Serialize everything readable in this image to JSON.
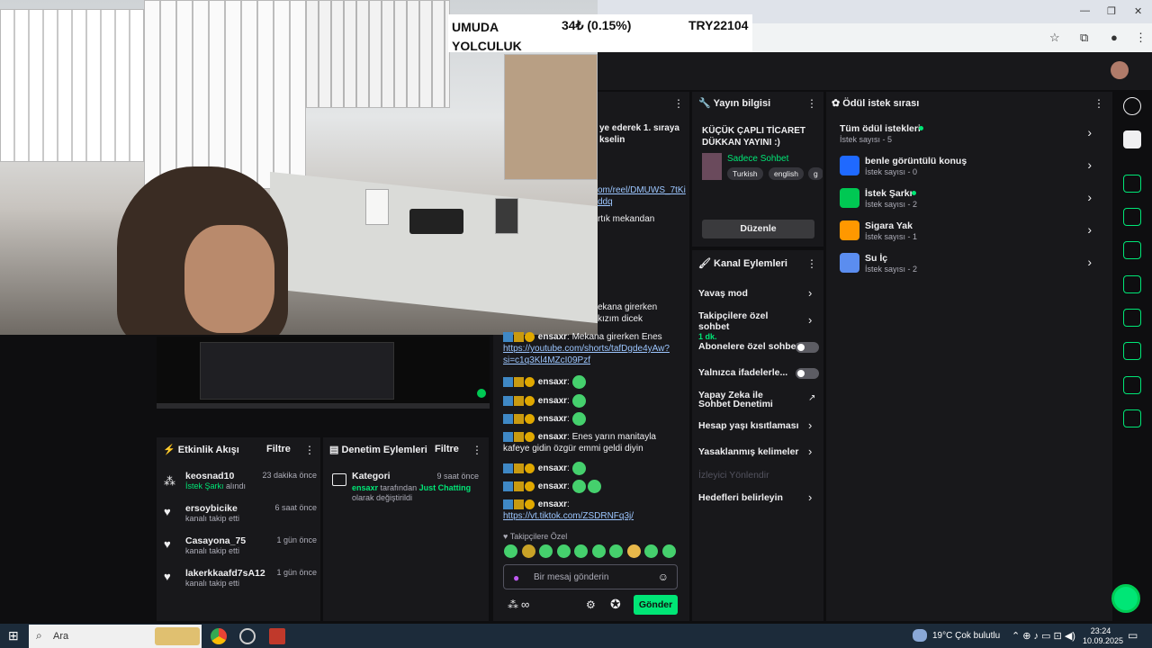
{
  "ticker": {
    "name": "UMUDA YOLCULUK",
    "change": "34₺ (0.15%)",
    "total": "TRY22104"
  },
  "chat_top": {
    "line1": "ye ederek 1. sıraya",
    "line2": "kselin",
    "link1a": "om/reel/DMUWS_7tKi",
    "link1b": "ddq",
    "line3": "rtık mekandan",
    "line4": "ekana girerken",
    "line5": "kızım dicek"
  },
  "stream_info": {
    "header": "Yayın bilgisi",
    "title": "KÜÇÜK ÇAPLI TİCARET DÜKKAN YAYINI :)",
    "category": "Sadece Sohbet",
    "tags": [
      "Turkish",
      "english",
      "g"
    ],
    "edit_button": "Düzenle"
  },
  "channel_actions": {
    "header": "Kanal Eylemleri",
    "items": [
      {
        "label": "Yavaş mod"
      },
      {
        "label": "Takipçilere özel sohbet",
        "sub": "1 dk."
      },
      {
        "label": "Abonelere özel sohbet"
      },
      {
        "label": "Yalnızca ifadelerle..."
      },
      {
        "label": "Yapay Zeka ile Sohbet Denetimi"
      },
      {
        "label": "Hesap yaşı kısıtlaması"
      },
      {
        "label": "Yasaklanmış kelimeler"
      },
      {
        "label": "İzleyici Yönlendir"
      },
      {
        "label": "Hedefleri belirleyin"
      }
    ]
  },
  "rewards": {
    "header": "Ödül istek sırası",
    "all": {
      "title": "Tüm ödül istekleri",
      "sub": "İstek sayısı - 5"
    },
    "items": [
      {
        "title": "benle görüntülü konuş",
        "sub": "İstek sayısı - 0",
        "color": "#1f69ff"
      },
      {
        "title": "İstek Şarkı",
        "sub": "İstek sayısı - 2",
        "color": "#00c853"
      },
      {
        "title": "Sigara Yak",
        "sub": "İstek sayısı - 1",
        "color": "#ff9800"
      },
      {
        "title": "Su İç",
        "sub": "İstek sayısı - 2",
        "color": "#5b8def"
      }
    ]
  },
  "activity": {
    "header": "Etkinlik Akışı",
    "filter": "Filtre",
    "items": [
      {
        "name": "keosnad10",
        "time": "23 dakika önce",
        "sub_hl": "İstek Şarkı",
        "sub": "alındı",
        "icon": "reward-icon"
      },
      {
        "name": "ersoybicike",
        "time": "6 saat önce",
        "sub": "kanalı takip etti",
        "icon": "heart-icon"
      },
      {
        "name": "Casayona_75",
        "time": "1 gün önce",
        "sub": "kanalı takip etti",
        "icon": "heart-icon"
      },
      {
        "name": "lakerkkaafd7sA12",
        "time": "1 gün önce",
        "sub": "kanalı takip etti",
        "icon": "heart-icon"
      }
    ]
  },
  "moderation": {
    "header": "Denetim Eylemleri",
    "filter": "Filtre",
    "item": {
      "title": "Kategori",
      "time": "9 saat önce",
      "user": "ensaxr",
      "mid": "tarafından",
      "value": "Just Chatting",
      "end": "olarak değiştirildi"
    }
  },
  "chat": {
    "user": "ensaxr",
    "msg1": "Mekana girerken Enes",
    "link1a": "https://youtube.com/shorts/tafDgde4yAw?",
    "link1b": "si=c1q3Kl4MZcI09Pzf",
    "msg2": "Enes yarın manitayla kafeye gidin özgür emmi geldi diyin",
    "link2": "https://vt.tiktok.com/ZSDRNFq3j/",
    "followers_only": "Takipçilere Özel",
    "placeholder": "Bir mesaj gönderin",
    "send": "Gönder",
    "infinity": "∞"
  },
  "taskbar": {
    "search": "Ara",
    "weather": "19°C  Çok bulutlu",
    "time": "23:24",
    "date": "10.09.2025"
  }
}
